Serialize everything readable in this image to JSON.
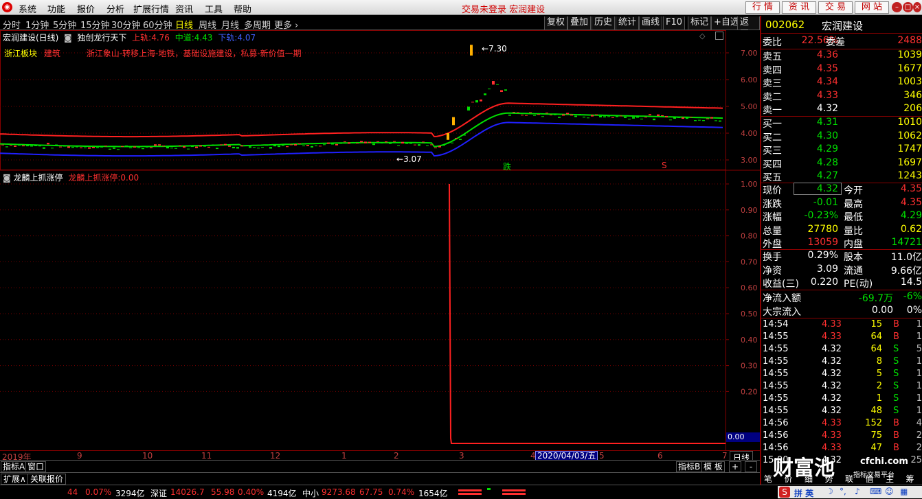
{
  "menu": {
    "items": [
      "系统",
      "功能",
      "报价",
      "分析",
      "扩展行情",
      "资讯",
      "工具",
      "帮助"
    ],
    "title": "交易未登录 宏润建设",
    "right_buttons": [
      "行 情",
      "资 讯",
      "交 易",
      "网 站"
    ]
  },
  "periods": [
    "分时",
    "1分钟",
    "5分钟",
    "15分钟",
    "30分钟",
    "60分钟",
    "日线",
    "周线",
    "月线",
    "多周期",
    "更多 ›"
  ],
  "selected_period": "日线",
  "tools": [
    "复权",
    "叠加",
    "历史",
    "统计",
    "画线",
    "F10",
    "标记",
    "+自选",
    "返回"
  ],
  "main_chart": {
    "title": "宏润建设(日线)",
    "indicator": "独创龙行天下",
    "upper_label": "上轨:",
    "upper_value": "4.76",
    "mid_label": "中道:",
    "mid_value": "4.43",
    "lower_label": "下轨:",
    "lower_value": "4.07",
    "board": "浙江板块",
    "sector": "建筑",
    "concepts": "浙江象山-转移上海-地铁，基础设施建设，私募-新价值一期",
    "high_mark": "7.30",
    "low_mark": "3.07",
    "marker_die": "跌",
    "marker_s": "S",
    "yticks": [
      "7.00",
      "6.00",
      "5.00",
      "4.00",
      "3.00"
    ]
  },
  "sub_chart": {
    "title": "龙麟上抓涨停",
    "label": "龙麟上抓涨停:",
    "value": "0.00",
    "yticks": [
      "1.00",
      "0.90",
      "0.80",
      "0.70",
      "0.60",
      "0.50",
      "0.40",
      "0.30",
      "0.20"
    ],
    "current": "0.00"
  },
  "xaxis": {
    "year": "2019年",
    "months": [
      "9",
      "10",
      "11",
      "12",
      "1",
      "2",
      "3",
      "4",
      "5",
      "6",
      "7"
    ],
    "cursor_date": "2020/04/03/五",
    "period_btn": "日线"
  },
  "bottom_tabs": {
    "row1": [
      "指标A",
      "窗口"
    ],
    "row1_right": [
      "指标B",
      "模 板",
      "+",
      "-"
    ],
    "row2": [
      "扩展∧",
      "关联报价"
    ]
  },
  "quote": {
    "code": "002062",
    "name": "宏润建设",
    "weibi_label": "委比",
    "weibi": "22.56%",
    "weicha_label": "委差",
    "weicha": "2488",
    "sells": [
      {
        "label": "卖五",
        "price": "4.36",
        "vol": "1039"
      },
      {
        "label": "卖四",
        "price": "4.35",
        "vol": "1677"
      },
      {
        "label": "卖三",
        "price": "4.34",
        "vol": "1003"
      },
      {
        "label": "卖二",
        "price": "4.33",
        "vol": "346"
      },
      {
        "label": "卖一",
        "price": "4.32",
        "vol": "206"
      }
    ],
    "buys": [
      {
        "label": "买一",
        "price": "4.31",
        "vol": "1010"
      },
      {
        "label": "买二",
        "price": "4.30",
        "vol": "1062"
      },
      {
        "label": "买三",
        "price": "4.29",
        "vol": "1747"
      },
      {
        "label": "买四",
        "price": "4.28",
        "vol": "1697"
      },
      {
        "label": "买五",
        "price": "4.27",
        "vol": "1243"
      }
    ],
    "stats": [
      {
        "l1": "现价",
        "v1": "4.32",
        "l2": "今开",
        "v2": "4.35"
      },
      {
        "l1": "涨跌",
        "v1": "-0.01",
        "l2": "最高",
        "v2": "4.35"
      },
      {
        "l1": "涨幅",
        "v1": "-0.23%",
        "l2": "最低",
        "v2": "4.29"
      },
      {
        "l1": "总量",
        "v1": "27780",
        "l2": "量比",
        "v2": "0.62"
      },
      {
        "l1": "外盘",
        "v1": "13059",
        "l2": "内盘",
        "v2": "14721"
      }
    ],
    "stats2": [
      {
        "l1": "换手",
        "v1": "0.29%",
        "l2": "股本",
        "v2": "11.0亿"
      },
      {
        "l1": "净资",
        "v1": "3.09",
        "l2": "流通",
        "v2": "9.66亿"
      },
      {
        "l1": "收益(三)",
        "v1": "0.220",
        "l2": "PE(动)",
        "v2": "14.5"
      }
    ],
    "flow": [
      {
        "label": "净流入额",
        "value": "-69.7万",
        "pct": "-6%"
      },
      {
        "label": "大宗流入",
        "value": "0.00",
        "pct": "0%"
      }
    ],
    "ticks": [
      {
        "t": "14:54",
        "p": "4.33",
        "v": "15",
        "bs": "B",
        "n": "1"
      },
      {
        "t": "14:55",
        "p": "4.33",
        "v": "64",
        "bs": "B",
        "n": "1"
      },
      {
        "t": "14:55",
        "p": "4.32",
        "v": "64",
        "bs": "S",
        "n": "5"
      },
      {
        "t": "14:55",
        "p": "4.32",
        "v": "8",
        "bs": "S",
        "n": "1"
      },
      {
        "t": "14:55",
        "p": "4.32",
        "v": "5",
        "bs": "S",
        "n": "1"
      },
      {
        "t": "14:55",
        "p": "4.32",
        "v": "2",
        "bs": "S",
        "n": "1"
      },
      {
        "t": "14:55",
        "p": "4.32",
        "v": "1",
        "bs": "S",
        "n": "1"
      },
      {
        "t": "14:55",
        "p": "4.32",
        "v": "48",
        "bs": "S",
        "n": "1"
      },
      {
        "t": "14:56",
        "p": "4.33",
        "v": "152",
        "bs": "B",
        "n": "4"
      },
      {
        "t": "14:56",
        "p": "4.33",
        "v": "75",
        "bs": "B",
        "n": "2"
      },
      {
        "t": "14:56",
        "p": "4.33",
        "v": "47",
        "bs": "B",
        "n": "2"
      },
      {
        "t": "15:00",
        "p": "4.32",
        "v": "",
        "bs": "",
        "n": "25"
      }
    ],
    "bottom_tabs": [
      "笔",
      "价",
      "细",
      "势",
      "联",
      "值",
      "主",
      "筹"
    ]
  },
  "status": {
    "a1": "44",
    "a2": "0.07%",
    "a3": "3294亿",
    "sz_label": "深证",
    "sz": "14026.7",
    "sz_chg": "55.98",
    "sz_pct": "0.40%",
    "sz_amt": "4194亿",
    "zx_label": "中小",
    "zx": "9273.68",
    "zx_chg": "67.75",
    "zx_pct": "0.74%",
    "zx_amt": "1654亿"
  },
  "watermark": {
    "logo": "财富池",
    "url": "cfchi.com",
    "sub": "指标交易平台"
  },
  "ime": {
    "label": "拼 英"
  },
  "colors": {
    "up": "#ff3030",
    "down": "#00e000",
    "upper_band": "#ff2020",
    "mid_band": "#00e000",
    "lower_band": "#2020ff",
    "frame": "#800000"
  }
}
